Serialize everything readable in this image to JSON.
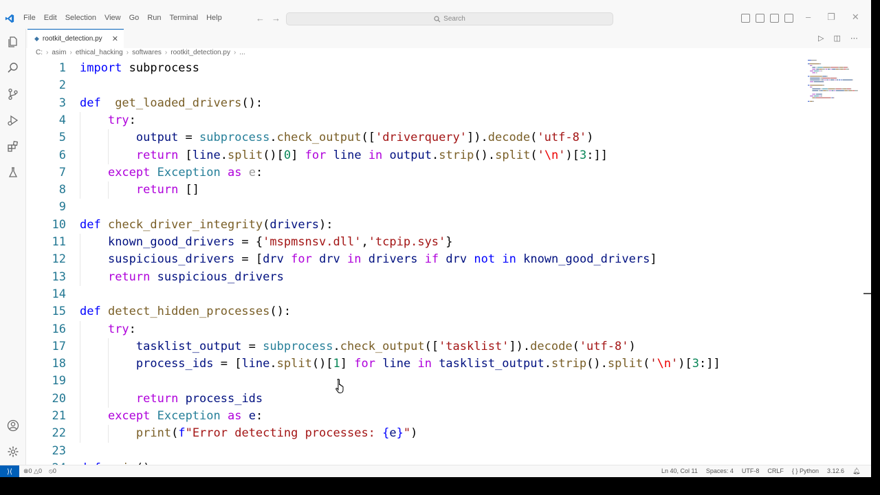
{
  "menu": [
    "File",
    "Edit",
    "Selection",
    "View",
    "Go",
    "Run",
    "Terminal",
    "Help"
  ],
  "search": {
    "placeholder": "Search"
  },
  "tab": {
    "label": "rootkit_detection.py",
    "icon_text": "◆"
  },
  "breadcrumb": [
    "C:",
    "asim",
    "ethical_hacking",
    "softwares",
    "rootkit_detection.py",
    "..."
  ],
  "status": {
    "errors": "0",
    "warnings": "0",
    "ports": "0",
    "position": "Ln 40, Col 11",
    "spaces": "Spaces: 4",
    "encoding": "UTF-8",
    "eol": "CRLF",
    "language": "Python",
    "version": "3.12.6"
  },
  "colors": {
    "accent": "#005fb8",
    "keyword": "#0000ff",
    "control": "#af00db",
    "function": "#795e26",
    "string": "#a31515",
    "class": "#267f99",
    "variable": "#001080",
    "line_number": "#237893"
  },
  "code_lines": [
    [
      [
        "kw",
        "import"
      ],
      [
        "",
        "subprocess"
      ]
    ],
    [],
    [
      [
        "kw",
        "def"
      ],
      [
        "fn",
        "get_loaded_drivers"
      ],
      [
        "",
        "():"
      ]
    ],
    [
      [
        "",
        "    "
      ],
      [
        "ctl",
        "try"
      ],
      [
        "",
        ":"
      ]
    ],
    [
      [
        "",
        "        "
      ],
      [
        "var",
        "output"
      ],
      [
        "",
        " = "
      ],
      [
        "cls",
        "subprocess"
      ],
      [
        "",
        "."
      ],
      [
        "fn",
        "check_output"
      ],
      [
        "",
        "(["
      ],
      [
        "str",
        "'driverquery'"
      ],
      [
        "",
        "])."
      ],
      [
        "fn",
        "decode"
      ],
      [
        "",
        "("
      ],
      [
        "str",
        "'utf-8'"
      ],
      [
        "",
        ")"
      ]
    ],
    [
      [
        "",
        "        "
      ],
      [
        "ctl",
        "return"
      ],
      [
        "",
        " ["
      ],
      [
        "var",
        "line"
      ],
      [
        "",
        "."
      ],
      [
        "fn",
        "split"
      ],
      [
        "",
        "()["
      ],
      [
        "num",
        "0"
      ],
      [
        "",
        "] "
      ],
      [
        "ctl",
        "for"
      ],
      [
        "",
        " "
      ],
      [
        "var",
        "line"
      ],
      [
        "",
        " "
      ],
      [
        "ctl",
        "in"
      ],
      [
        "",
        " "
      ],
      [
        "var",
        "output"
      ],
      [
        "",
        "."
      ],
      [
        "fn",
        "strip"
      ],
      [
        "",
        "()."
      ],
      [
        "fn",
        "split"
      ],
      [
        "",
        "("
      ],
      [
        "str",
        "'"
      ],
      [
        "esc",
        "\\n"
      ],
      [
        "str",
        "'"
      ],
      [
        "",
        ")["
      ],
      [
        "num",
        "3"
      ],
      [
        "",
        ":]]"
      ]
    ],
    [
      [
        "",
        "    "
      ],
      [
        "ctl",
        "except"
      ],
      [
        "",
        " "
      ],
      [
        "cls",
        "Exception"
      ],
      [
        "",
        " "
      ],
      [
        "ctl",
        "as"
      ],
      [
        "",
        " "
      ],
      [
        "dim",
        "e"
      ],
      [
        "",
        ":"
      ]
    ],
    [
      [
        "",
        "        "
      ],
      [
        "ctl",
        "return"
      ],
      [
        "",
        " []"
      ]
    ],
    [],
    [
      [
        "kw",
        "def"
      ],
      [
        "",
        " "
      ],
      [
        "fn",
        "check_driver_integrity"
      ],
      [
        "",
        "("
      ],
      [
        "var",
        "drivers"
      ],
      [
        "",
        "):"
      ]
    ],
    [
      [
        "",
        "    "
      ],
      [
        "var",
        "known_good_drivers"
      ],
      [
        "",
        " = {"
      ],
      [
        "str",
        "'mspmsnsv.dll'"
      ],
      [
        "",
        ","
      ],
      [
        "str",
        "'tcpip.sys'"
      ],
      [
        "",
        "}"
      ]
    ],
    [
      [
        "",
        "    "
      ],
      [
        "var",
        "suspicious_drivers"
      ],
      [
        "",
        " = ["
      ],
      [
        "var",
        "drv"
      ],
      [
        "",
        " "
      ],
      [
        "ctl",
        "for"
      ],
      [
        "",
        " "
      ],
      [
        "var",
        "drv"
      ],
      [
        "",
        " "
      ],
      [
        "ctl",
        "in"
      ],
      [
        "",
        " "
      ],
      [
        "var",
        "drivers"
      ],
      [
        "",
        " "
      ],
      [
        "ctl",
        "if"
      ],
      [
        "",
        " "
      ],
      [
        "var",
        "drv"
      ],
      [
        "",
        " "
      ],
      [
        "kw",
        "not"
      ],
      [
        "",
        " "
      ],
      [
        "kw",
        "in"
      ],
      [
        "",
        " "
      ],
      [
        "var",
        "known_good_drivers"
      ],
      [
        "",
        "]"
      ]
    ],
    [
      [
        "",
        "    "
      ],
      [
        "ctl",
        "return"
      ],
      [
        "",
        " "
      ],
      [
        "var",
        "suspicious_drivers"
      ]
    ],
    [],
    [
      [
        "kw",
        "def"
      ],
      [
        "",
        " "
      ],
      [
        "fn",
        "detect_hidden_processes"
      ],
      [
        "",
        "():"
      ]
    ],
    [
      [
        "",
        "    "
      ],
      [
        "ctl",
        "try"
      ],
      [
        "",
        ":"
      ]
    ],
    [
      [
        "",
        "        "
      ],
      [
        "var",
        "tasklist_output"
      ],
      [
        "",
        " = "
      ],
      [
        "cls",
        "subprocess"
      ],
      [
        "",
        "."
      ],
      [
        "fn",
        "check_output"
      ],
      [
        "",
        "(["
      ],
      [
        "str",
        "'tasklist'"
      ],
      [
        "",
        "])."
      ],
      [
        "fn",
        "decode"
      ],
      [
        "",
        "("
      ],
      [
        "str",
        "'utf-8'"
      ],
      [
        "",
        ")"
      ]
    ],
    [
      [
        "",
        "        "
      ],
      [
        "var",
        "process_ids"
      ],
      [
        "",
        " = ["
      ],
      [
        "var",
        "line"
      ],
      [
        "",
        "."
      ],
      [
        "fn",
        "split"
      ],
      [
        "",
        "()["
      ],
      [
        "num",
        "1"
      ],
      [
        "",
        "] "
      ],
      [
        "ctl",
        "for"
      ],
      [
        "",
        " "
      ],
      [
        "var",
        "line"
      ],
      [
        "",
        " "
      ],
      [
        "ctl",
        "in"
      ],
      [
        "",
        " "
      ],
      [
        "var",
        "tasklist_output"
      ],
      [
        "",
        "."
      ],
      [
        "fn",
        "strip"
      ],
      [
        "",
        "()."
      ],
      [
        "fn",
        "split"
      ],
      [
        "",
        "("
      ],
      [
        "str",
        "'"
      ],
      [
        "esc",
        "\\n"
      ],
      [
        "str",
        "'"
      ],
      [
        "",
        ")["
      ],
      [
        "num",
        "3"
      ],
      [
        "",
        ":]]"
      ]
    ],
    [],
    [
      [
        "",
        "        "
      ],
      [
        "ctl",
        "return"
      ],
      [
        "",
        " "
      ],
      [
        "var",
        "process_ids"
      ]
    ],
    [
      [
        "",
        "    "
      ],
      [
        "ctl",
        "except"
      ],
      [
        "",
        " "
      ],
      [
        "cls",
        "Exception"
      ],
      [
        "",
        " "
      ],
      [
        "ctl",
        "as"
      ],
      [
        "",
        " "
      ],
      [
        "var",
        "e"
      ],
      [
        "",
        ":"
      ]
    ],
    [
      [
        "",
        "        "
      ],
      [
        "fn",
        "print"
      ],
      [
        "",
        "("
      ],
      [
        "kw",
        "f"
      ],
      [
        "str",
        "\"Error detecting processes: "
      ],
      [
        "kw",
        "{"
      ],
      [
        "var",
        "e"
      ],
      [
        "kw",
        "}"
      ],
      [
        "str",
        "\""
      ],
      [
        "",
        ")"
      ]
    ],
    [],
    [
      [
        "kw",
        "def"
      ],
      [
        "",
        " "
      ],
      [
        "fn",
        "main"
      ],
      [
        "",
        "():"
      ]
    ]
  ]
}
